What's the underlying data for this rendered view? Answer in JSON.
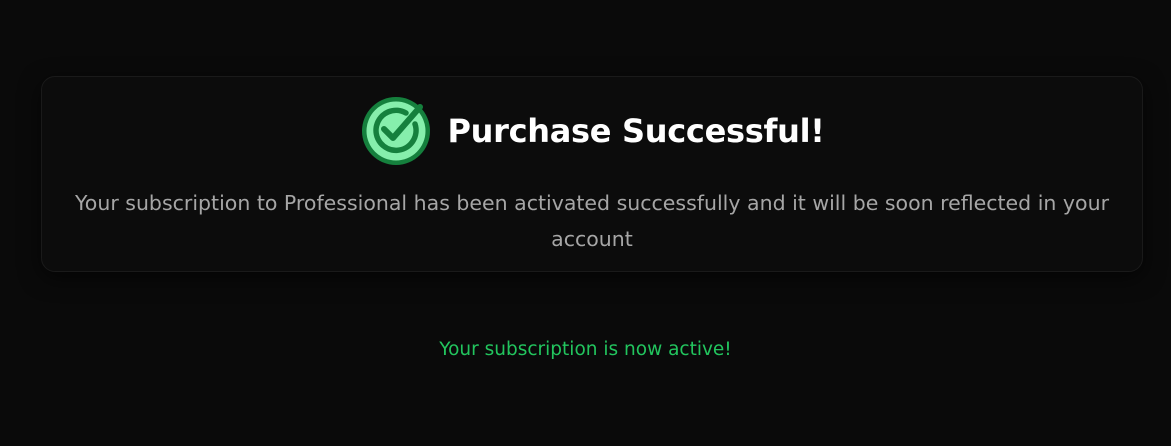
{
  "card": {
    "title": "Purchase Successful!",
    "message": "Your subscription to Professional has been activated successfully and it will be soon reflected in your account",
    "icon": "check-circle-icon"
  },
  "status": {
    "text": "Your subscription is now active!"
  },
  "colors": {
    "background": "#0a0a0a",
    "card_background": "#0c0c0c",
    "title": "#ffffff",
    "message": "#a6a6a6",
    "success": "#22c55e",
    "icon_fill": "#86efac",
    "icon_stroke": "#15803d"
  }
}
